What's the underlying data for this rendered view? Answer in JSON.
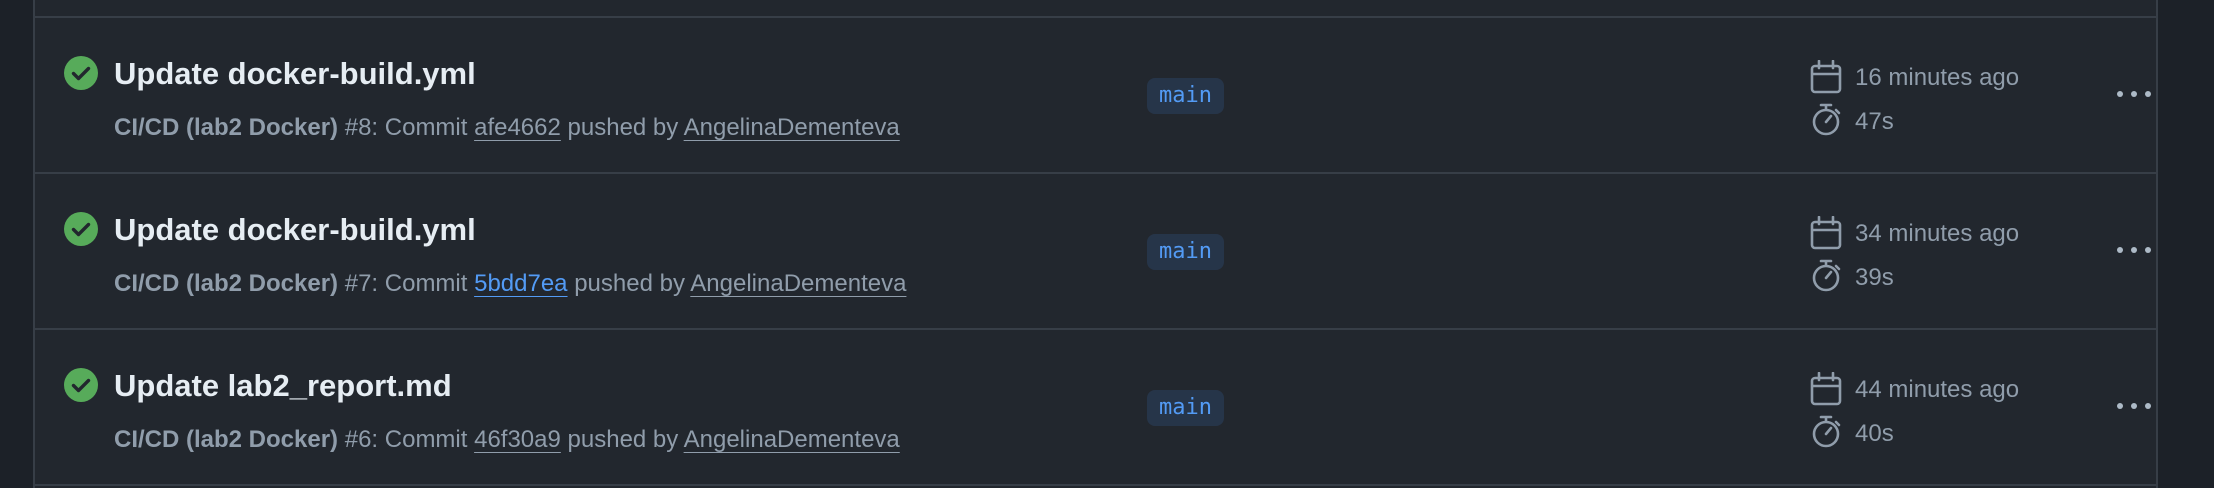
{
  "colors": {
    "background": "#22272e",
    "border": "#373e47",
    "success": "#57ab5a",
    "title_text": "#e6edf3",
    "muted_text": "#909dab",
    "link_blue": "#539bf5"
  },
  "icons": {
    "status": "check-circle-fill-icon",
    "created": "calendar-icon",
    "duration": "stopwatch-icon",
    "menu": "kebab-horizontal-icon"
  },
  "runs": [
    {
      "title": "Update docker-build.yml",
      "workflow": "CI/CD (lab2 Docker)",
      "run_number": " #8: Commit ",
      "sha": "afe4662",
      "pushed_by": " pushed by ",
      "actor": "AngelinaDementeva",
      "branch": "main",
      "time_ago": "16 minutes ago",
      "duration": "47s"
    },
    {
      "title": "Update docker-build.yml",
      "workflow": "CI/CD (lab2 Docker)",
      "run_number": " #7: Commit ",
      "sha": "5bdd7ea",
      "pushed_by": " pushed by ",
      "actor": "AngelinaDementeva",
      "branch": "main",
      "time_ago": "34 minutes ago",
      "duration": "39s"
    },
    {
      "title": "Update lab2_report.md",
      "workflow": "CI/CD (lab2 Docker)",
      "run_number": " #6: Commit ",
      "sha": "46f30a9",
      "pushed_by": " pushed by ",
      "actor": "AngelinaDementeva",
      "branch": "main",
      "time_ago": "44 minutes ago",
      "duration": "40s"
    }
  ]
}
